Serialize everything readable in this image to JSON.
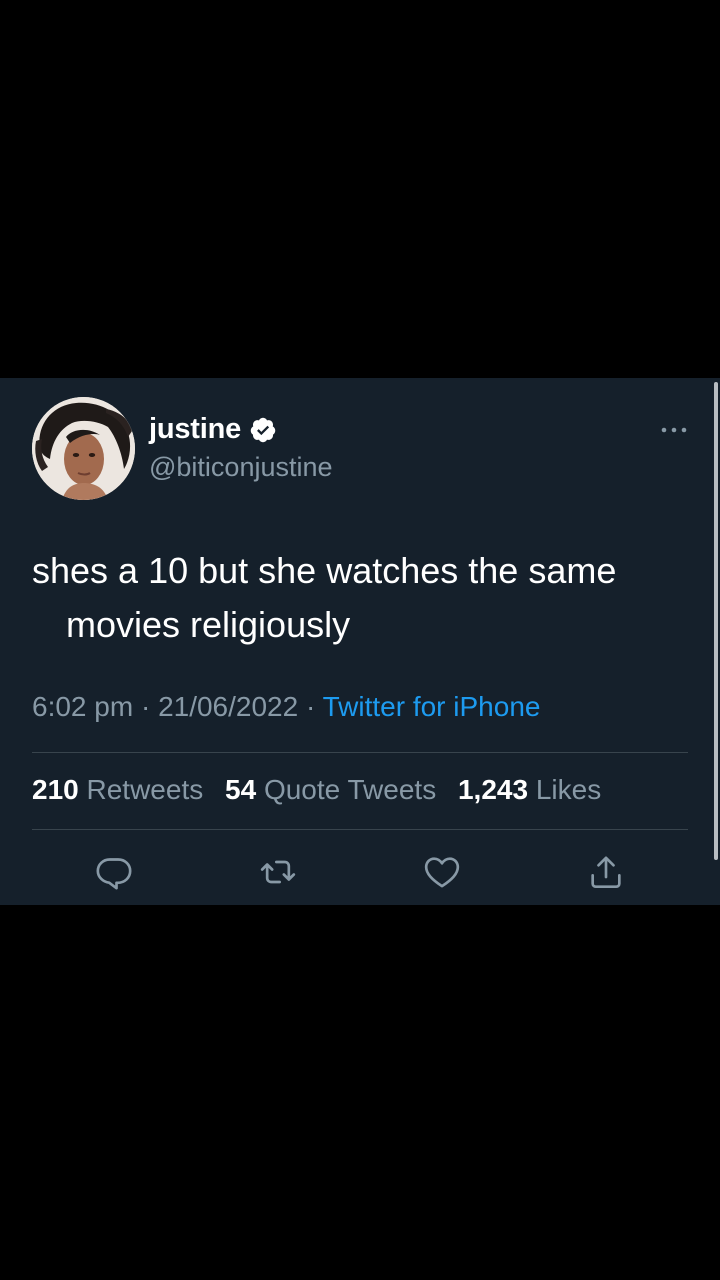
{
  "tweet": {
    "display_name": "justine",
    "handle": "@biticonjustine",
    "verified": true,
    "text_line1": "shes a 10 but she watches the same",
    "text_line2": "movies religiously",
    "time": "6:02 pm",
    "date": "21/06/2022",
    "separator": "·",
    "source": "Twitter for iPhone",
    "stats": [
      {
        "value": "210",
        "label": "Retweets"
      },
      {
        "value": "54",
        "label": "Quote Tweets"
      },
      {
        "value": "1,243",
        "label": "Likes"
      }
    ]
  },
  "icons": {
    "verified": "verified-badge-icon",
    "more": "more-options-icon",
    "reply": "reply-icon",
    "retweet": "retweet-icon",
    "like": "heart-icon",
    "share": "share-icon"
  },
  "colors": {
    "background": "#000000",
    "card": "#15202b",
    "text_primary": "#ffffff",
    "text_secondary": "#8899a6",
    "accent": "#1d9bf0",
    "divider": "#38444d"
  }
}
